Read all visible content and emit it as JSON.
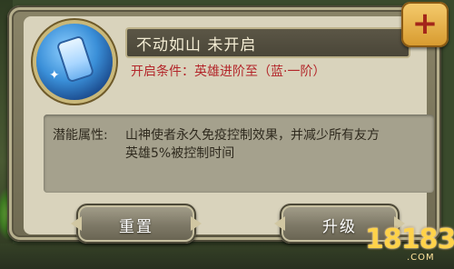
{
  "skill": {
    "title": "不动如山  未开启",
    "condition": "开启条件：英雄进阶至（蓝·一阶）",
    "icon": "blue-tablet-icon"
  },
  "description": {
    "label": "潜能属性:",
    "line1": "山神使者永久免疫控制效果，并减少所有友方",
    "line2": "英雄5%被控制时间"
  },
  "buttons": {
    "reset": "重置",
    "upgrade": "升级",
    "plus_symbol": "+"
  },
  "watermark": {
    "number": "18183",
    "suffix": ".COM"
  },
  "colors": {
    "condition_text": "#b3262a",
    "panel_bg": "#d9d3bc",
    "title_bar": "#4a4638"
  }
}
